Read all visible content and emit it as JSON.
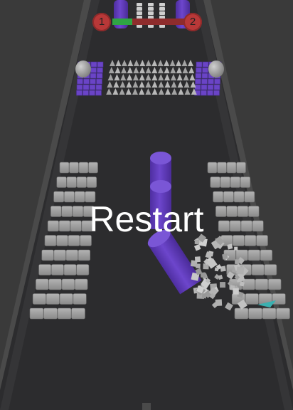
{
  "hud": {
    "current_level": "1",
    "next_level": "2",
    "progress_fraction": 0.27,
    "colors": {
      "progress_fill": "#2fa544",
      "progress_track": "#8e2c2c",
      "level_badge": "#b83838"
    }
  },
  "overlay": {
    "restart_label": "Restart"
  },
  "scene_colors": {
    "background": "#3a3a3a",
    "road": "#2b2b2d",
    "road_edge": "#4b4b4b",
    "rail": "#545454",
    "pillar": "#6a3fc2",
    "block": "#9a9a9a",
    "block_purple": "#6a44c6",
    "spike": "#b0b0b0",
    "boulder": "#a8a8a8",
    "splash": "#3ab0b0"
  }
}
